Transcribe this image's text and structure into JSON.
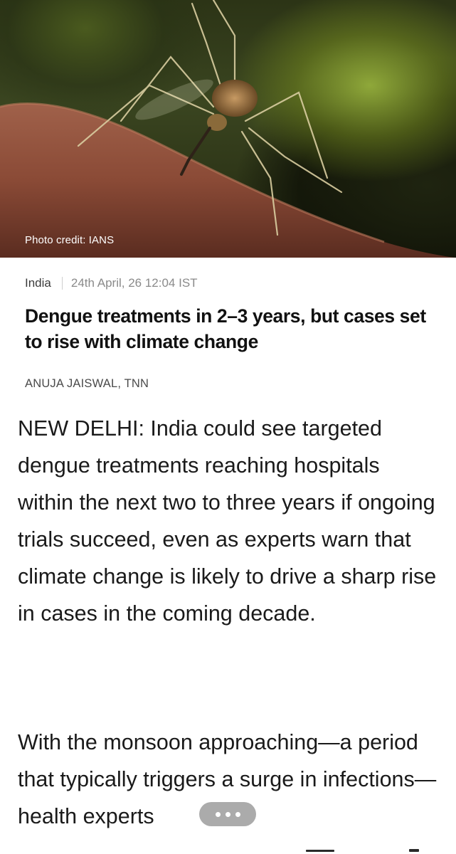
{
  "hero": {
    "image_subject": "mosquito on skin",
    "photo_credit": "Photo credit: IANS"
  },
  "article": {
    "section": "India",
    "date": "24th April, 26 12:04 IST",
    "headline": "Dengue treatments in 2–3 years, but cases set to rise with climate change",
    "byline": "ANUJA JAISWAL, TNN",
    "paragraphs": [
      "NEW DELHI: India could see targeted dengue treatments reaching hospitals within the next two to three years if ongoing trials succeed, even as experts warn that climate change is likely to drive a sharp rise in cases in the coming decade.",
      "With the monsoon approaching—a period that typically triggers a surge in infections—health experts"
    ]
  },
  "controls": {
    "more_icon": "ellipsis-icon"
  },
  "colors": {
    "headline": "#111111",
    "date": "#8a8a8a",
    "body_text": "#1a1a1a",
    "pill": "#787878"
  }
}
